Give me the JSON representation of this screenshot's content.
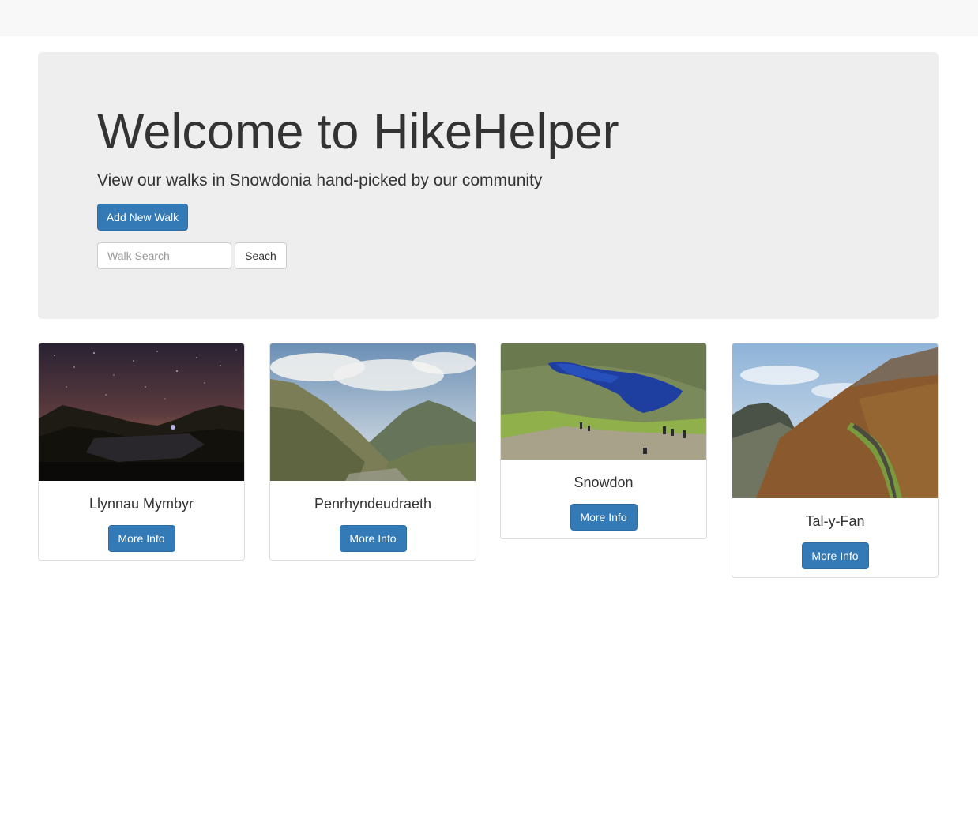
{
  "hero": {
    "title": "Welcome to HikeHelper",
    "lead": "View our walks in Snowdonia hand-picked by our community",
    "add_button_label": "Add New Walk",
    "search_placeholder": "Walk Search",
    "search_button_label": "Seach"
  },
  "walks": [
    {
      "name": "Llynnau Mymbyr",
      "button_label": "More Info"
    },
    {
      "name": "Penrhyndeudraeth",
      "button_label": "More Info"
    },
    {
      "name": "Snowdon",
      "button_label": "More Info"
    },
    {
      "name": "Tal-y-Fan",
      "button_label": "More Info"
    }
  ],
  "colors": {
    "primary": "#337ab7",
    "jumbotron_bg": "#eeeeee",
    "navbar_bg": "#f8f8f8"
  }
}
